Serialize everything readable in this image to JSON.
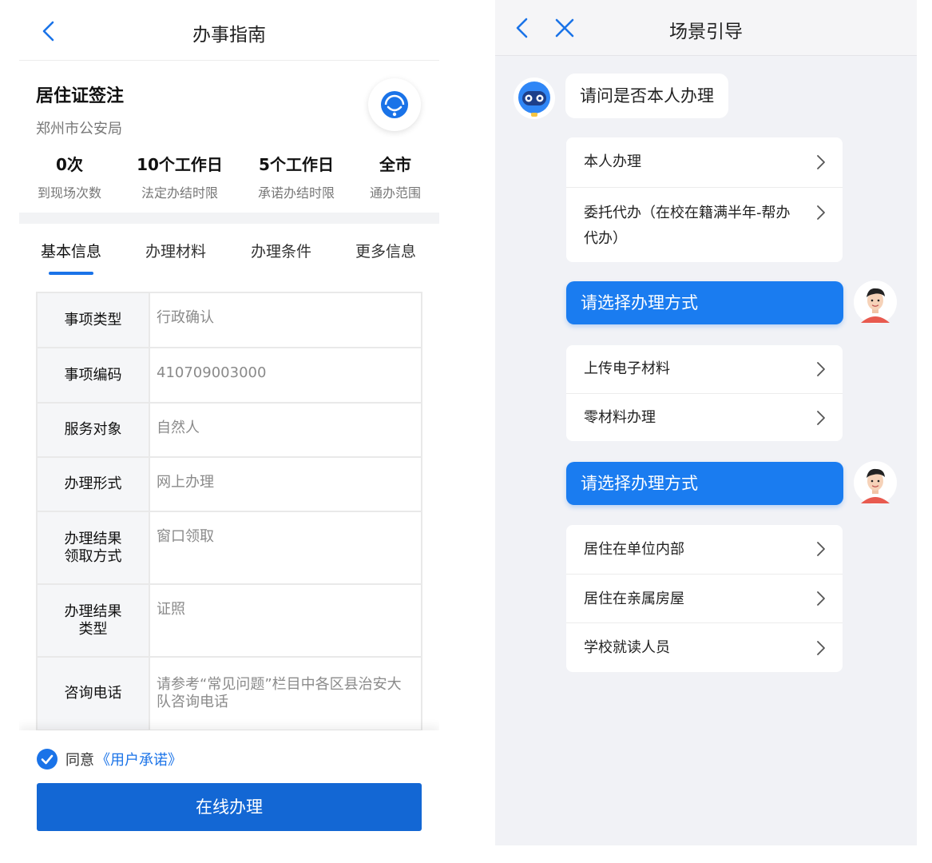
{
  "left": {
    "title": "办事指南",
    "service_name": "居住证签注",
    "organization": "郑州市公安局",
    "stats": [
      {
        "value": "0次",
        "label": "到现场次数"
      },
      {
        "value": "10个工作日",
        "label": "法定办结时限"
      },
      {
        "value": "5个工作日",
        "label": "承诺办结时限"
      },
      {
        "value": "全市",
        "label": "通办范围"
      }
    ],
    "tabs": [
      "基本信息",
      "办理材料",
      "办理条件",
      "更多信息"
    ],
    "active_tab": "基本信息",
    "rows": [
      {
        "key": "事项类型",
        "value": "行政确认"
      },
      {
        "key": "事项编码",
        "value": "410709003000"
      },
      {
        "key": "服务对象",
        "value": "自然人"
      },
      {
        "key": "办理形式",
        "value": "网上办理"
      },
      {
        "key": "办理结果\n领取方式",
        "value": "窗口领取"
      },
      {
        "key": "办理结果\n类型",
        "value": "证照"
      },
      {
        "key": "咨询电话",
        "value": "请参考“常见问题”栏目中各区县治安大队咨询电话"
      }
    ],
    "agree_text": "同意",
    "agree_link": "《用户承诺》",
    "agree_checked": true,
    "apply_button": "在线办理",
    "accent_color": "#1a73e8"
  },
  "right": {
    "title": "场景引导",
    "bot_question": "请问是否本人办理",
    "options_1": [
      "本人办理",
      "委托代办（在校在籍满半年-帮办代办）"
    ],
    "user_reply_1": "请选择办理方式",
    "options_2": [
      "上传电子材料",
      "零材料办理"
    ],
    "user_reply_2": "请选择办理方式",
    "options_3": [
      "居住在单位内部",
      "居住在亲属房屋",
      "学校就读人员"
    ],
    "bubble_color": "#1a7cf0"
  }
}
